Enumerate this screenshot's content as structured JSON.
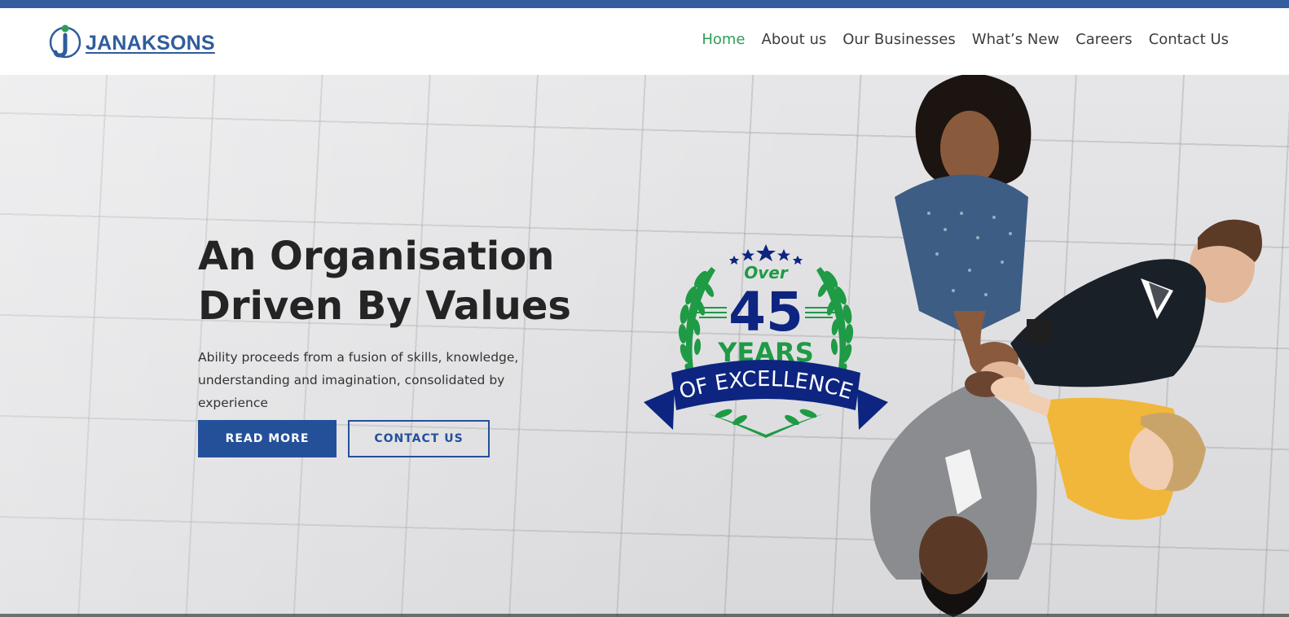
{
  "brand": {
    "name": "JANAKSONS",
    "logo_icon": "janaksons-j-logo",
    "color_primary": "#2f5c9c",
    "color_accent": "#2e9e57"
  },
  "nav": {
    "items": [
      {
        "label": "Home",
        "active": true
      },
      {
        "label": "About us",
        "active": false
      },
      {
        "label": "Our Businesses",
        "active": false
      },
      {
        "label": "What’s New",
        "active": false
      },
      {
        "label": "Careers",
        "active": false
      },
      {
        "label": "Contact Us",
        "active": false
      }
    ]
  },
  "hero": {
    "title_line1": "An Organisation",
    "title_line2": "Driven By Values",
    "subtitle": "Ability proceeds from a fusion of skills, knowledge, understanding and imagination, consolidated by experience",
    "primary_button": "READ MORE",
    "secondary_button": "CONTACT US"
  },
  "badge": {
    "over": "Over",
    "number": "45",
    "years": "YEARS",
    "ribbon": "OF EXCELLENCE",
    "color_green": "#1f9a45",
    "color_navy": "#0d2580"
  }
}
